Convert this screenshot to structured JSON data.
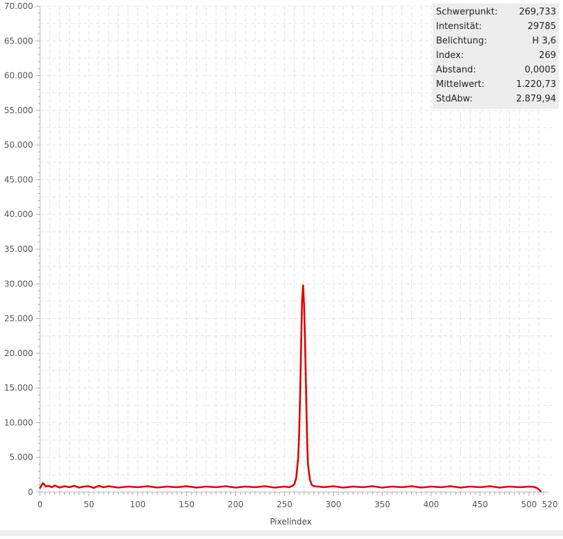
{
  "chart_data": {
    "type": "line",
    "title": "",
    "xlabel": "Pixelindex",
    "ylabel": "",
    "xlim": [
      0,
      520
    ],
    "ylim": [
      0,
      70000
    ],
    "x_ticks": [
      "0",
      "50",
      "100",
      "150",
      "200",
      "250",
      "300",
      "350",
      "400",
      "450",
      "500",
      "520"
    ],
    "y_ticks": [
      "0",
      "5.000",
      "10.000",
      "15.000",
      "20.000",
      "25.000",
      "30.000",
      "35.000",
      "40.000",
      "45.000",
      "50.000",
      "55.000",
      "60.000",
      "65.000",
      "70.000"
    ],
    "grid": true,
    "legend": "none",
    "series": [
      {
        "color": "#e00000",
        "x": [
          0,
          3,
          6,
          9,
          12,
          15,
          20,
          25,
          30,
          35,
          40,
          45,
          50,
          55,
          60,
          65,
          70,
          80,
          90,
          100,
          110,
          120,
          130,
          140,
          150,
          160,
          170,
          180,
          190,
          200,
          210,
          220,
          230,
          240,
          250,
          255,
          258,
          260,
          262,
          264,
          265,
          266,
          267,
          268,
          269,
          270,
          271,
          272,
          273,
          274,
          276,
          278,
          280,
          285,
          290,
          300,
          310,
          320,
          330,
          340,
          350,
          360,
          370,
          380,
          390,
          400,
          410,
          420,
          430,
          440,
          450,
          460,
          470,
          480,
          490,
          500,
          505,
          508,
          510,
          511,
          512
        ],
        "y": [
          600,
          1300,
          800,
          900,
          700,
          950,
          650,
          850,
          700,
          900,
          650,
          800,
          850,
          600,
          900,
          700,
          850,
          650,
          800,
          700,
          850,
          650,
          800,
          700,
          850,
          650,
          800,
          700,
          850,
          650,
          800,
          700,
          850,
          650,
          800,
          700,
          900,
          1100,
          2000,
          5000,
          8500,
          14000,
          21000,
          27500,
          29785,
          27000,
          22000,
          15000,
          8500,
          4000,
          1800,
          1000,
          850,
          800,
          700,
          850,
          650,
          800,
          700,
          850,
          650,
          800,
          700,
          850,
          650,
          800,
          700,
          850,
          650,
          800,
          700,
          850,
          650,
          800,
          700,
          800,
          750,
          600,
          400,
          250,
          100
        ]
      }
    ]
  },
  "info": {
    "rows": [
      {
        "label": "Schwerpunkt:",
        "value": "269,733"
      },
      {
        "label": "Intensität:",
        "value": "29785"
      },
      {
        "label": "Belichtung:",
        "value": "H 3,6"
      },
      {
        "label": "Index:",
        "value": "269"
      },
      {
        "label": "Abstand:",
        "value": "0,0005"
      },
      {
        "label": "Mittelwert:",
        "value": "1.220,73"
      },
      {
        "label": "StdAbw:",
        "value": "2.879,94"
      }
    ]
  }
}
